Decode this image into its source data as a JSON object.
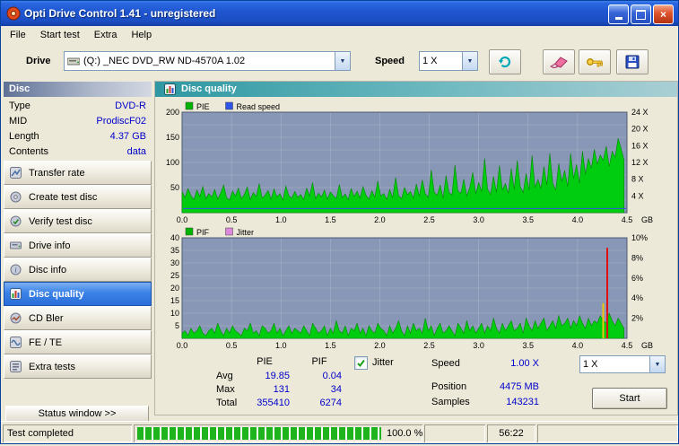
{
  "window": {
    "title": "Opti Drive Control 1.41  -  unregistered"
  },
  "menu": {
    "items": [
      "File",
      "Start test",
      "Extra",
      "Help"
    ]
  },
  "toolbar": {
    "drive_label": "Drive",
    "drive_value": "(Q:)  _NEC DVD_RW ND-4570A 1.02",
    "speed_label": "Speed",
    "speed_value": "1 X"
  },
  "sidebar": {
    "header": "Disc",
    "info": [
      {
        "label": "Type",
        "value": "DVD-R"
      },
      {
        "label": "MID",
        "value": "ProdiscF02"
      },
      {
        "label": "Length",
        "value": "4.37 GB"
      },
      {
        "label": "Contents",
        "value": "data"
      }
    ],
    "buttons": [
      {
        "label": "Transfer rate"
      },
      {
        "label": "Create test disc"
      },
      {
        "label": "Verify test disc"
      },
      {
        "label": "Drive info"
      },
      {
        "label": "Disc info"
      },
      {
        "label": "Disc quality"
      },
      {
        "label": "CD Bler"
      },
      {
        "label": "FE / TE"
      },
      {
        "label": "Extra tests"
      }
    ],
    "selected": "Disc quality",
    "status_button": "Status window >>"
  },
  "main": {
    "header": "Disc quality"
  },
  "chart_data": [
    {
      "type": "area",
      "title": "PIE / Read speed",
      "legend": [
        {
          "label": "PIE",
          "color": "#00b400"
        },
        {
          "label": "Read speed",
          "color": "#2f55e8"
        }
      ],
      "x_unit": "GB",
      "xlim": [
        0,
        4.5
      ],
      "x_ticks": [
        0.0,
        0.5,
        1.0,
        1.5,
        2.0,
        2.5,
        3.0,
        3.5,
        4.0,
        4.5
      ],
      "ylim": [
        0,
        200
      ],
      "y_ticks": [
        200,
        150,
        100,
        50
      ],
      "y_grid_step": 25,
      "ylim_right": [
        0,
        24
      ],
      "y_ticks_right": [
        {
          "v": 24,
          "label": "24 X"
        },
        {
          "v": 20,
          "label": "20 X"
        },
        {
          "v": 16,
          "label": "16 X"
        },
        {
          "v": 12,
          "label": "12 X"
        },
        {
          "v": 8,
          "label": "8 X"
        },
        {
          "v": 4,
          "label": "4 X"
        }
      ],
      "x_step": 0.03,
      "series_color": "#00cc10",
      "read_speed": {
        "value": 1.0,
        "color": "#2f55e8"
      },
      "values": [
        42,
        30,
        48,
        34,
        26,
        45,
        32,
        52,
        28,
        38,
        31,
        46,
        27,
        39,
        55,
        30,
        25,
        43,
        33,
        49,
        28,
        36,
        51,
        26,
        40,
        32,
        58,
        29,
        35,
        44,
        27,
        47,
        31,
        38,
        25,
        53,
        34,
        29,
        42,
        30,
        36,
        26,
        49,
        33,
        60,
        28,
        39,
        31,
        45,
        27,
        41,
        34,
        28,
        56,
        30,
        37,
        26,
        48,
        32,
        43,
        29,
        52,
        35,
        27,
        44,
        31,
        63,
        33,
        38,
        26,
        46,
        30,
        70,
        34,
        28,
        50,
        36,
        42,
        29,
        57,
        33,
        65,
        38,
        30,
        85,
        41,
        34,
        55,
        29,
        74,
        40,
        35,
        95,
        44,
        38,
        67,
        33,
        50,
        80,
        37,
        60,
        42,
        108,
        47,
        36,
        72,
        40,
        94,
        45,
        58,
        38,
        88,
        46,
        104,
        52,
        40,
        78,
        45,
        114,
        50,
        66,
        48,
        92,
        55,
        118,
        58,
        45,
        98,
        62,
        84,
        52,
        118,
        68,
        96,
        58,
        122,
        76,
        108,
        88,
        126,
        96,
        115,
        104,
        132,
        92,
        122,
        110,
        148,
        128,
        105
      ]
    },
    {
      "type": "area",
      "title": "PIF / Jitter",
      "legend": [
        {
          "label": "PIF",
          "color": "#00b400"
        },
        {
          "label": "Jitter",
          "color": "#dd88dd"
        }
      ],
      "x_unit": "GB",
      "xlim": [
        0,
        4.5
      ],
      "x_ticks": [
        0.0,
        0.5,
        1.0,
        1.5,
        2.0,
        2.5,
        3.0,
        3.5,
        4.0,
        4.5
      ],
      "ylim": [
        0,
        40
      ],
      "y_ticks": [
        40,
        35,
        30,
        25,
        20,
        15,
        10,
        5
      ],
      "y_grid_step": 5,
      "ylim_right": [
        0,
        10
      ],
      "y_ticks_right": [
        {
          "v": 10,
          "label": "10%"
        },
        {
          "v": 8,
          "label": "8%"
        },
        {
          "v": 6,
          "label": "6%"
        },
        {
          "v": 4,
          "label": "4%"
        },
        {
          "v": 2,
          "label": "2%"
        }
      ],
      "x_step": 0.03,
      "series_color": "#00cc10",
      "spikes": [
        {
          "x": 4.26,
          "value": 14,
          "color": "#f2c40f"
        },
        {
          "x": 4.3,
          "value": 36,
          "color": "#e01010"
        }
      ],
      "values": [
        2,
        3,
        1,
        4,
        2,
        3,
        5,
        2,
        1,
        3,
        4,
        2,
        6,
        3,
        1,
        4,
        2,
        5,
        3,
        2,
        1,
        4,
        3,
        6,
        2,
        3,
        1,
        5,
        4,
        2,
        3,
        6,
        2,
        4,
        1,
        3,
        5,
        2,
        4,
        3,
        2,
        5,
        3,
        1,
        6,
        4,
        2,
        3,
        5,
        1,
        4,
        2,
        7,
        3,
        2,
        5,
        1,
        4,
        3,
        6,
        2,
        4,
        1,
        5,
        3,
        2,
        6,
        4,
        3,
        1,
        5,
        2,
        4,
        7,
        3,
        1,
        5,
        2,
        6,
        3,
        4,
        2,
        8,
        3,
        5,
        1,
        4,
        6,
        2,
        3,
        5,
        3,
        1,
        6,
        4,
        2,
        7,
        3,
        5,
        2,
        4,
        6,
        2,
        5,
        3,
        8,
        4,
        2,
        6,
        3,
        5,
        7,
        3,
        4,
        6,
        2,
        8,
        5,
        3,
        7,
        4,
        6,
        8,
        3,
        5,
        7,
        4,
        9,
        5,
        6,
        8,
        4,
        7,
        5,
        9,
        6,
        4,
        8,
        5,
        7,
        6,
        9,
        7,
        6,
        10,
        7,
        5,
        8,
        6,
        4
      ]
    }
  ],
  "stats": {
    "col1": "PIE",
    "col2": "PIF",
    "rows": [
      {
        "label": "Avg",
        "pie": "19.85",
        "pif": "0.04"
      },
      {
        "label": "Max",
        "pie": "131",
        "pif": "34"
      },
      {
        "label": "Total",
        "pie": "355410",
        "pif": "6274"
      }
    ],
    "jitter_label": "Jitter",
    "jitter_checked": true,
    "speed_label": "Speed",
    "speed_value": "1.00 X",
    "position_label": "Position",
    "position_value": "4475 MB",
    "samples_label": "Samples",
    "samples_value": "143231",
    "speed_select": "1 X",
    "start_button": "Start"
  },
  "statusbar": {
    "text": "Test completed",
    "percent": "100.0 %",
    "time": "56:22"
  },
  "colors": {
    "value_text": "#0000cc",
    "pie_green": "#00cc10",
    "read_speed_blue": "#2f55e8",
    "jitter_pink": "#dd88dd",
    "selected_nav": "#3b82e8",
    "spike_red": "#e01010",
    "spike_yellow": "#f2c40f"
  }
}
